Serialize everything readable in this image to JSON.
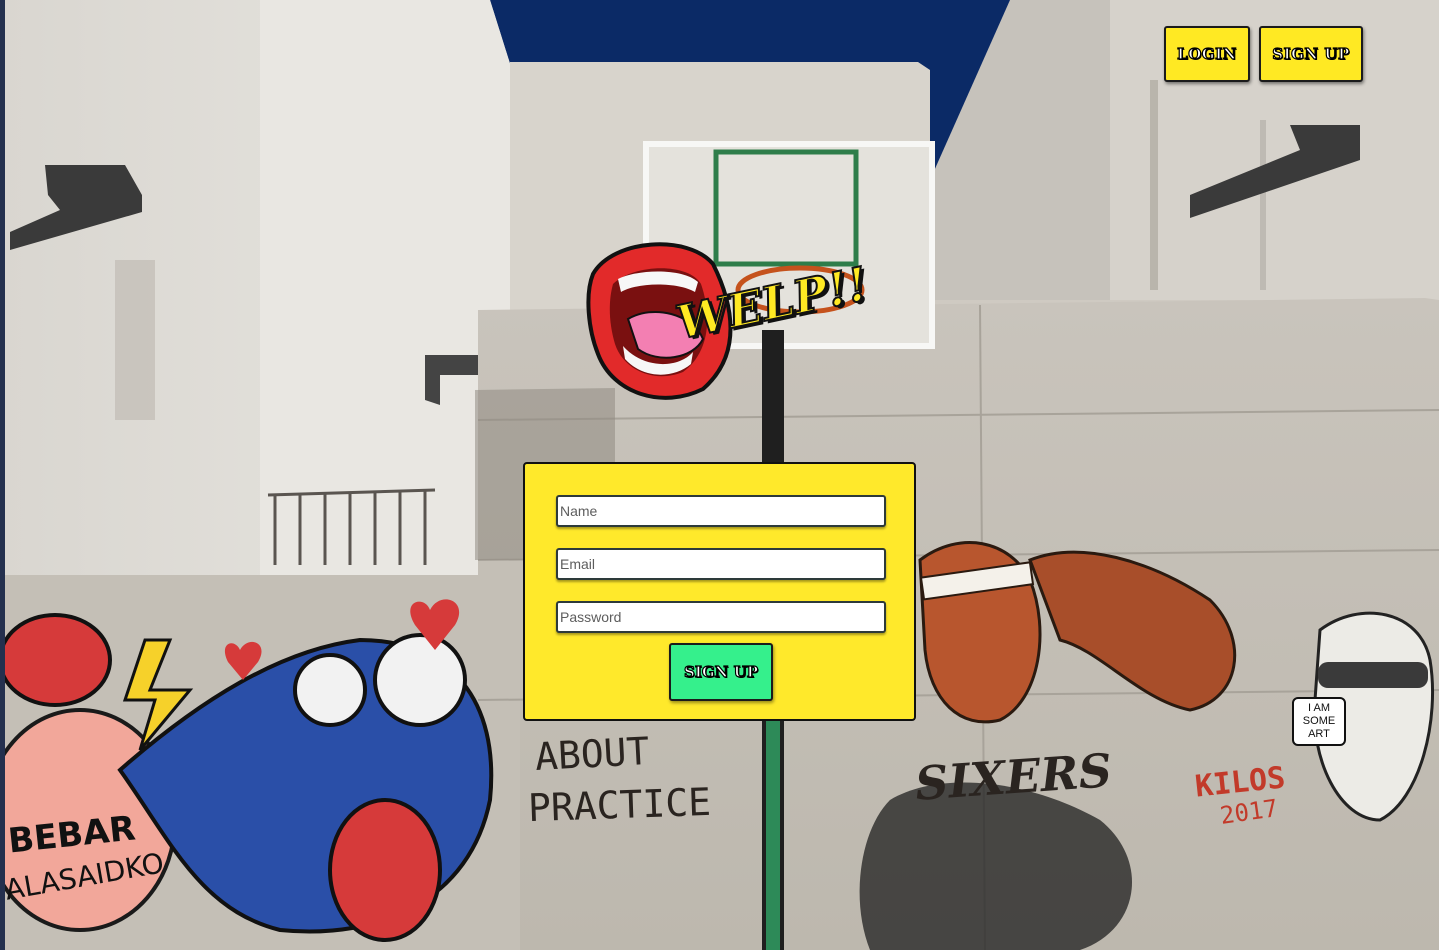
{
  "nav": {
    "login_label": "LOGIN",
    "signup_label": "SIGN UP"
  },
  "logo": {
    "text": "WELP!!",
    "icon": "open-mouth-icon"
  },
  "signup_form": {
    "name_placeholder": "Name",
    "email_placeholder": "Email",
    "password_placeholder": "Password",
    "submit_label": "SIGN UP"
  },
  "graffiti": {
    "wall_text_1": "ABOUT",
    "wall_text_2": "PRACTICE",
    "wall_text_3": "SIXERS",
    "wall_text_4": "BEBAR",
    "wall_text_5": "ALASAIDKO",
    "wall_text_6": "KILOS",
    "wall_text_7": "2017",
    "wall_text_8": "I AM SOME ART"
  },
  "colors": {
    "accent_yellow": "#ffe923",
    "accent_green": "#35f08c",
    "sky": "#0b2a66"
  }
}
